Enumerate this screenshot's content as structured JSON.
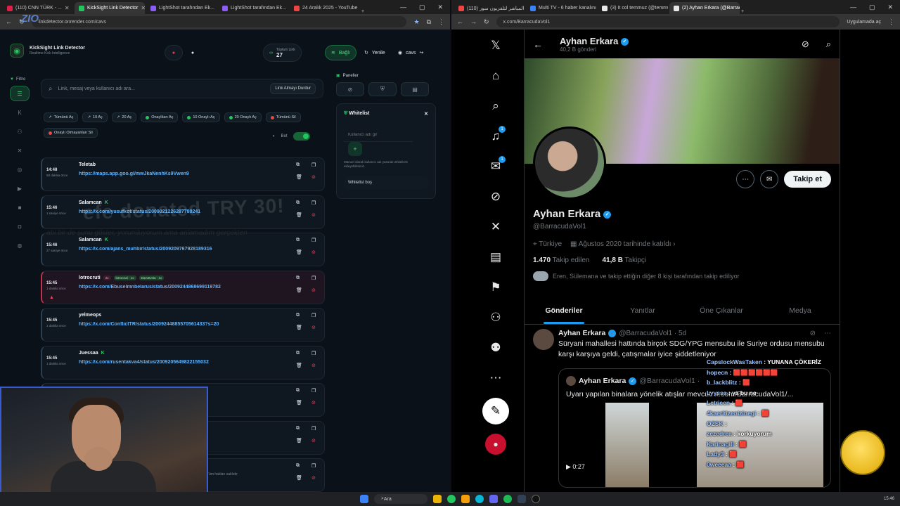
{
  "left_browser": {
    "tabs": [
      {
        "label": "(110) CNN TÜRK - ...",
        "color": "#e11d48",
        "active": false
      },
      {
        "label": "KickSight Link Detector",
        "color": "#22c55e",
        "active": true
      },
      {
        "label": "LightShot tarafından Ek...",
        "color": "#8b5cf6",
        "active": false
      },
      {
        "label": "LightShot tarafından Ek...",
        "color": "#8b5cf6",
        "active": false
      },
      {
        "label": "24 Aralık 2025 - YouTube",
        "color": "#ef4444",
        "active": false
      }
    ],
    "url": "linkdetector.onrender.com/cavs"
  },
  "app": {
    "title": "KickSight Link Detector",
    "subtitle": "Realtime Kick Intelligence",
    "total_label": "Toplam Link",
    "total_value": "27",
    "connected_label": "Bağlı",
    "refresh_label": "Yenile",
    "user_label": "cavs",
    "filter_label": "Filtre",
    "search_placeholder": "Link, mesaj veya kullanıcı adı ara...",
    "stop_label": "Link Almayı Durdur",
    "chips": [
      {
        "label": "Tümünü Aç",
        "dot": ""
      },
      {
        "label": "10 Aç",
        "dot": ""
      },
      {
        "label": "20 Aç",
        "dot": ""
      },
      {
        "label": "Onaylıları Aç",
        "dot": "#22c55e"
      },
      {
        "label": "10 Onaylı Aç",
        "dot": "#22c55e"
      },
      {
        "label": "20 Onaylı Aç",
        "dot": "#22c55e"
      },
      {
        "label": "Tümünü Sil",
        "dot": "#ef4444"
      },
      {
        "label": "Onaylı Olmayanları Sil",
        "dot": "#ef4444"
      }
    ],
    "bot_label": "Bot",
    "panels_label": "Paneller",
    "whitelist": {
      "title": "Whitelist",
      "input_placeholder": "Kullanıcı adı gir",
      "note": "Manuel olarak kullanıcı adı yazarak whitelist'e ekleyebilirsiniz.",
      "empty": "Whitelist boş"
    },
    "feed": [
      {
        "time": "14:48",
        "ago": "58 dakika önce",
        "user": "Teletab",
        "verified": false,
        "badges": [],
        "link": "https://maps.app.goo.gl/mwJkaNenhKs9Vwen9",
        "alert": false
      },
      {
        "time": "15:46",
        "ago": "1 saniye önce",
        "user": "Salamcan",
        "verified": true,
        "badges": [],
        "link": "https://x.com/yusufkot/status/2009021226287780241",
        "alert": false
      },
      {
        "time": "15:46",
        "ago": "27 saniye önce",
        "user": "Salamcan",
        "verified": true,
        "badges": [],
        "link": "https://x.com/ajans_muhbir/status/2009209767928189316",
        "alert": false
      },
      {
        "time": "15:45",
        "ago": "1 dakika önce",
        "user": "lotrocruti",
        "verified": false,
        "badges": [
          "2x",
          "lotrocruti - 1x",
          "DavutUsta - 1x"
        ],
        "link": "https://x.com/Ebuselmnbelarus/status/2009244868699119782",
        "alert": true
      },
      {
        "time": "15:45",
        "ago": "1 dakika önce",
        "user": "yelmeops",
        "verified": false,
        "badges": [],
        "link": "https://x.com/ConflictTR/status/2009244885570561433?s=20",
        "alert": false
      },
      {
        "time": "15:45",
        "ago": "1 dakika önce",
        "user": "Juessaa",
        "verified": true,
        "badges": [],
        "link": "https://x.com/rusentakva4/status/2009205649822155032",
        "alert": false
      },
      {
        "time": "",
        "ago": "",
        "user": "",
        "verified": false,
        "badges": [],
        "link": "44477857149423",
        "alert": false
      },
      {
        "time": "",
        "ago": "",
        "user": "",
        "verified": false,
        "badges": [],
        "link": "46293402/video/1",
        "alert": false
      },
      {
        "time": "",
        "ago": "",
        "user": "",
        "verified": false,
        "badges": [],
        "link": "",
        "alert": false
      }
    ],
    "ghost_text": "efe donated TRY 30!",
    "ghost_sub": "abi bir de şunu göster, yorumluyorum ama anlamadım gerçekten",
    "footer": "Tüm hakları saklıdır"
  },
  "right_browser": {
    "tabs": [
      {
        "label": "(110) البث المباشر لتلفزيون سور",
        "color": "#ef4444",
        "active": false
      },
      {
        "label": "Multi TV - 6 haber kanalını ayn",
        "color": "#3b82f6",
        "active": false
      },
      {
        "label": "(3) It col temmuz (@temmuz1...",
        "color": "#e7e9ea",
        "active": false
      },
      {
        "label": "(2) Ayhan Erkara (@Barracuda...",
        "color": "#e7e9ea",
        "active": true
      }
    ],
    "url": "x.com/BarracudaVol1",
    "update_label": "Uygulamada aç"
  },
  "x": {
    "nav_counts": {
      "notifications": "1",
      "messages": "1"
    },
    "header_name": "Ayhan Erkara",
    "header_posts": "40,2 B gönderi",
    "name": "Ayhan Erkara",
    "handle": "@BarracudaVol1",
    "location": "Türkiye",
    "joined": "Ağustos 2020 tarihinde katıldı",
    "following_count": "1.470",
    "following_label": "Takip edilen",
    "followers_count": "41,8 B",
    "followers_label": "Takipçi",
    "known": "Eren, Sülemana ve takip ettiğin diğer 8 kişi tarafından takip ediliyor",
    "follow_label": "Takip et",
    "tabs": [
      "Gönderiler",
      "Yanıtlar",
      "Öne Çıkanlar",
      "Medya"
    ],
    "tweet": {
      "name": "Ayhan Erkara",
      "meta": "@BarracudaVol1 · 5d",
      "text": "Süryani mahallesi hattında birçok SDG/YPG mensubu ile Suriye ordusu mensubu karşı karşıya geldi, çatışmalar iyice şiddetleniyor",
      "quote_name": "Ayhan Erkara",
      "quote_handle": "@BarracudaVol1 ·",
      "quote_text": "Uyarı yapılan binalara yönelik atışlar mevcut. x.com/BarracudaVol1/...",
      "video_time": "0:27"
    }
  },
  "chat": [
    {
      "user": "CapslockWasTaken",
      "msg": "YUNANA ÇÖKERİZ"
    },
    {
      "user": "hopecn",
      "msg": "🟥🟥🟥🟥🟥🟥"
    },
    {
      "user": "b_lackblitz",
      "msg": "🟥"
    },
    {
      "user": "Lyyssa",
      "msg": "ya bu ne"
    },
    {
      "user": "Letrieen",
      "msg": "🟥"
    },
    {
      "user": "4kaeritizenizinegi",
      "msg": "🟥"
    },
    {
      "user": "OZSK",
      "msg": ""
    },
    {
      "user": "zezedrea",
      "msg": "korkuyorum"
    },
    {
      "user": "Karinagill",
      "msg": "🟥"
    },
    {
      "user": "Lady3",
      "msg": "🟥"
    },
    {
      "user": "0weeeaa",
      "msg": "🟥"
    }
  ],
  "overlay_logo": "ZIO",
  "taskbar": {
    "search": "Ara",
    "time": "15:46"
  }
}
